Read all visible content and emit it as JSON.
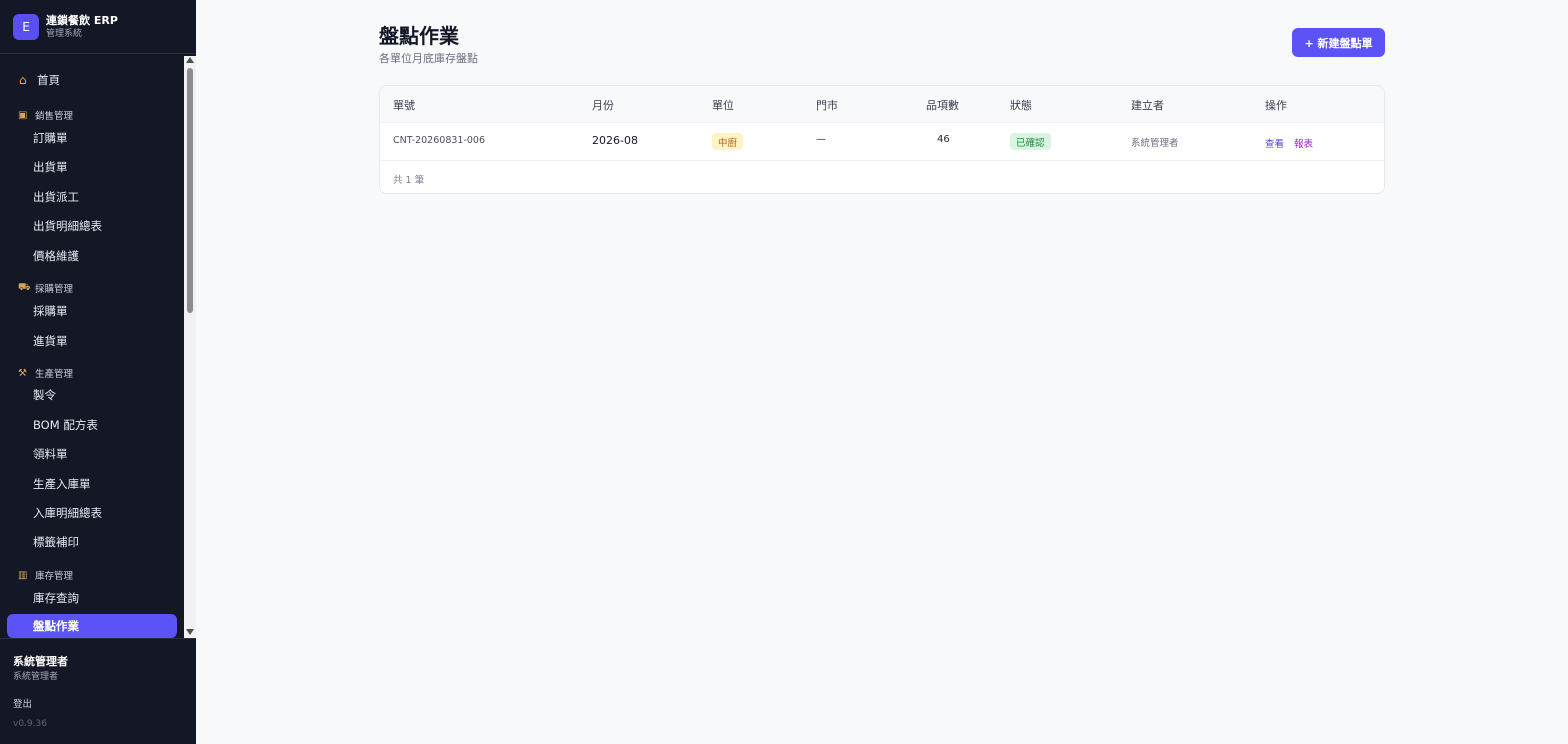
{
  "app": {
    "logo_letter": "E",
    "title": "連鎖餐飲 ERP",
    "subtitle": "管理系統"
  },
  "nav": {
    "home": "首頁",
    "sales_section": "銷售管理",
    "sales_items": [
      "訂購單",
      "出貨單",
      "出貨派工",
      "出貨明細總表",
      "價格維護"
    ],
    "purchase_section": "採購管理",
    "purchase_items": [
      "採購單",
      "進貨單"
    ],
    "production_section": "生產管理",
    "production_items": [
      "製令",
      "BOM 配方表",
      "領料單",
      "生產入庫單",
      "入庫明細總表",
      "標籤補印"
    ],
    "inventory_section": "庫存管理",
    "inventory_items": [
      "庫存查詢",
      "盤點作業"
    ]
  },
  "user": {
    "name": "系統管理者",
    "role": "系統管理者",
    "logout": "登出",
    "version": "v0.9.36"
  },
  "page": {
    "title": "盤點作業",
    "subtitle": "各單位月底庫存盤點",
    "new_button": "+ 新建盤點單"
  },
  "table": {
    "headers": [
      "單號",
      "月份",
      "單位",
      "門市",
      "品項數",
      "狀態",
      "建立者",
      "操作"
    ],
    "rows": [
      {
        "code": "CNT-20260831-006",
        "month": "2026-08",
        "unit": "中廚",
        "store": "—",
        "item_count": "46",
        "status": "已確認",
        "creator": "系統管理者",
        "action_view": "查看",
        "action_report": "報表"
      }
    ],
    "footer": "共 1 筆"
  },
  "colors": {
    "sidebar_bg": "#141726",
    "accent": "#5b53f5",
    "unit_badge_bg": "#fdf3c4",
    "status_badge_bg": "#d9f5e0"
  }
}
